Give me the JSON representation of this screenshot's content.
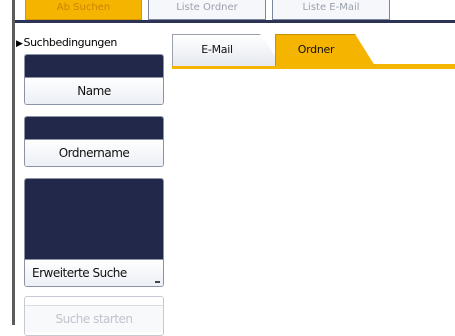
{
  "top_bar": {
    "buttons": [
      "Ab Suchen",
      "Liste Ordner",
      "Liste E-Mail"
    ]
  },
  "search_panel": {
    "title": "Suchbedingungen",
    "title_icon": "triangle-right-icon",
    "fields": [
      {
        "label": "Name",
        "value": ""
      },
      {
        "label": "Ordnername",
        "value": ""
      },
      {
        "label": "Erweiterte Suche",
        "value": ""
      }
    ],
    "start_button": "Suche starten"
  },
  "tabs": [
    {
      "label": "E-Mail",
      "active": false
    },
    {
      "label": "Ordner",
      "active": true
    }
  ],
  "colors": {
    "accent": "#f5b400",
    "field_fill": "#22284a",
    "border": "#8d93a6"
  }
}
